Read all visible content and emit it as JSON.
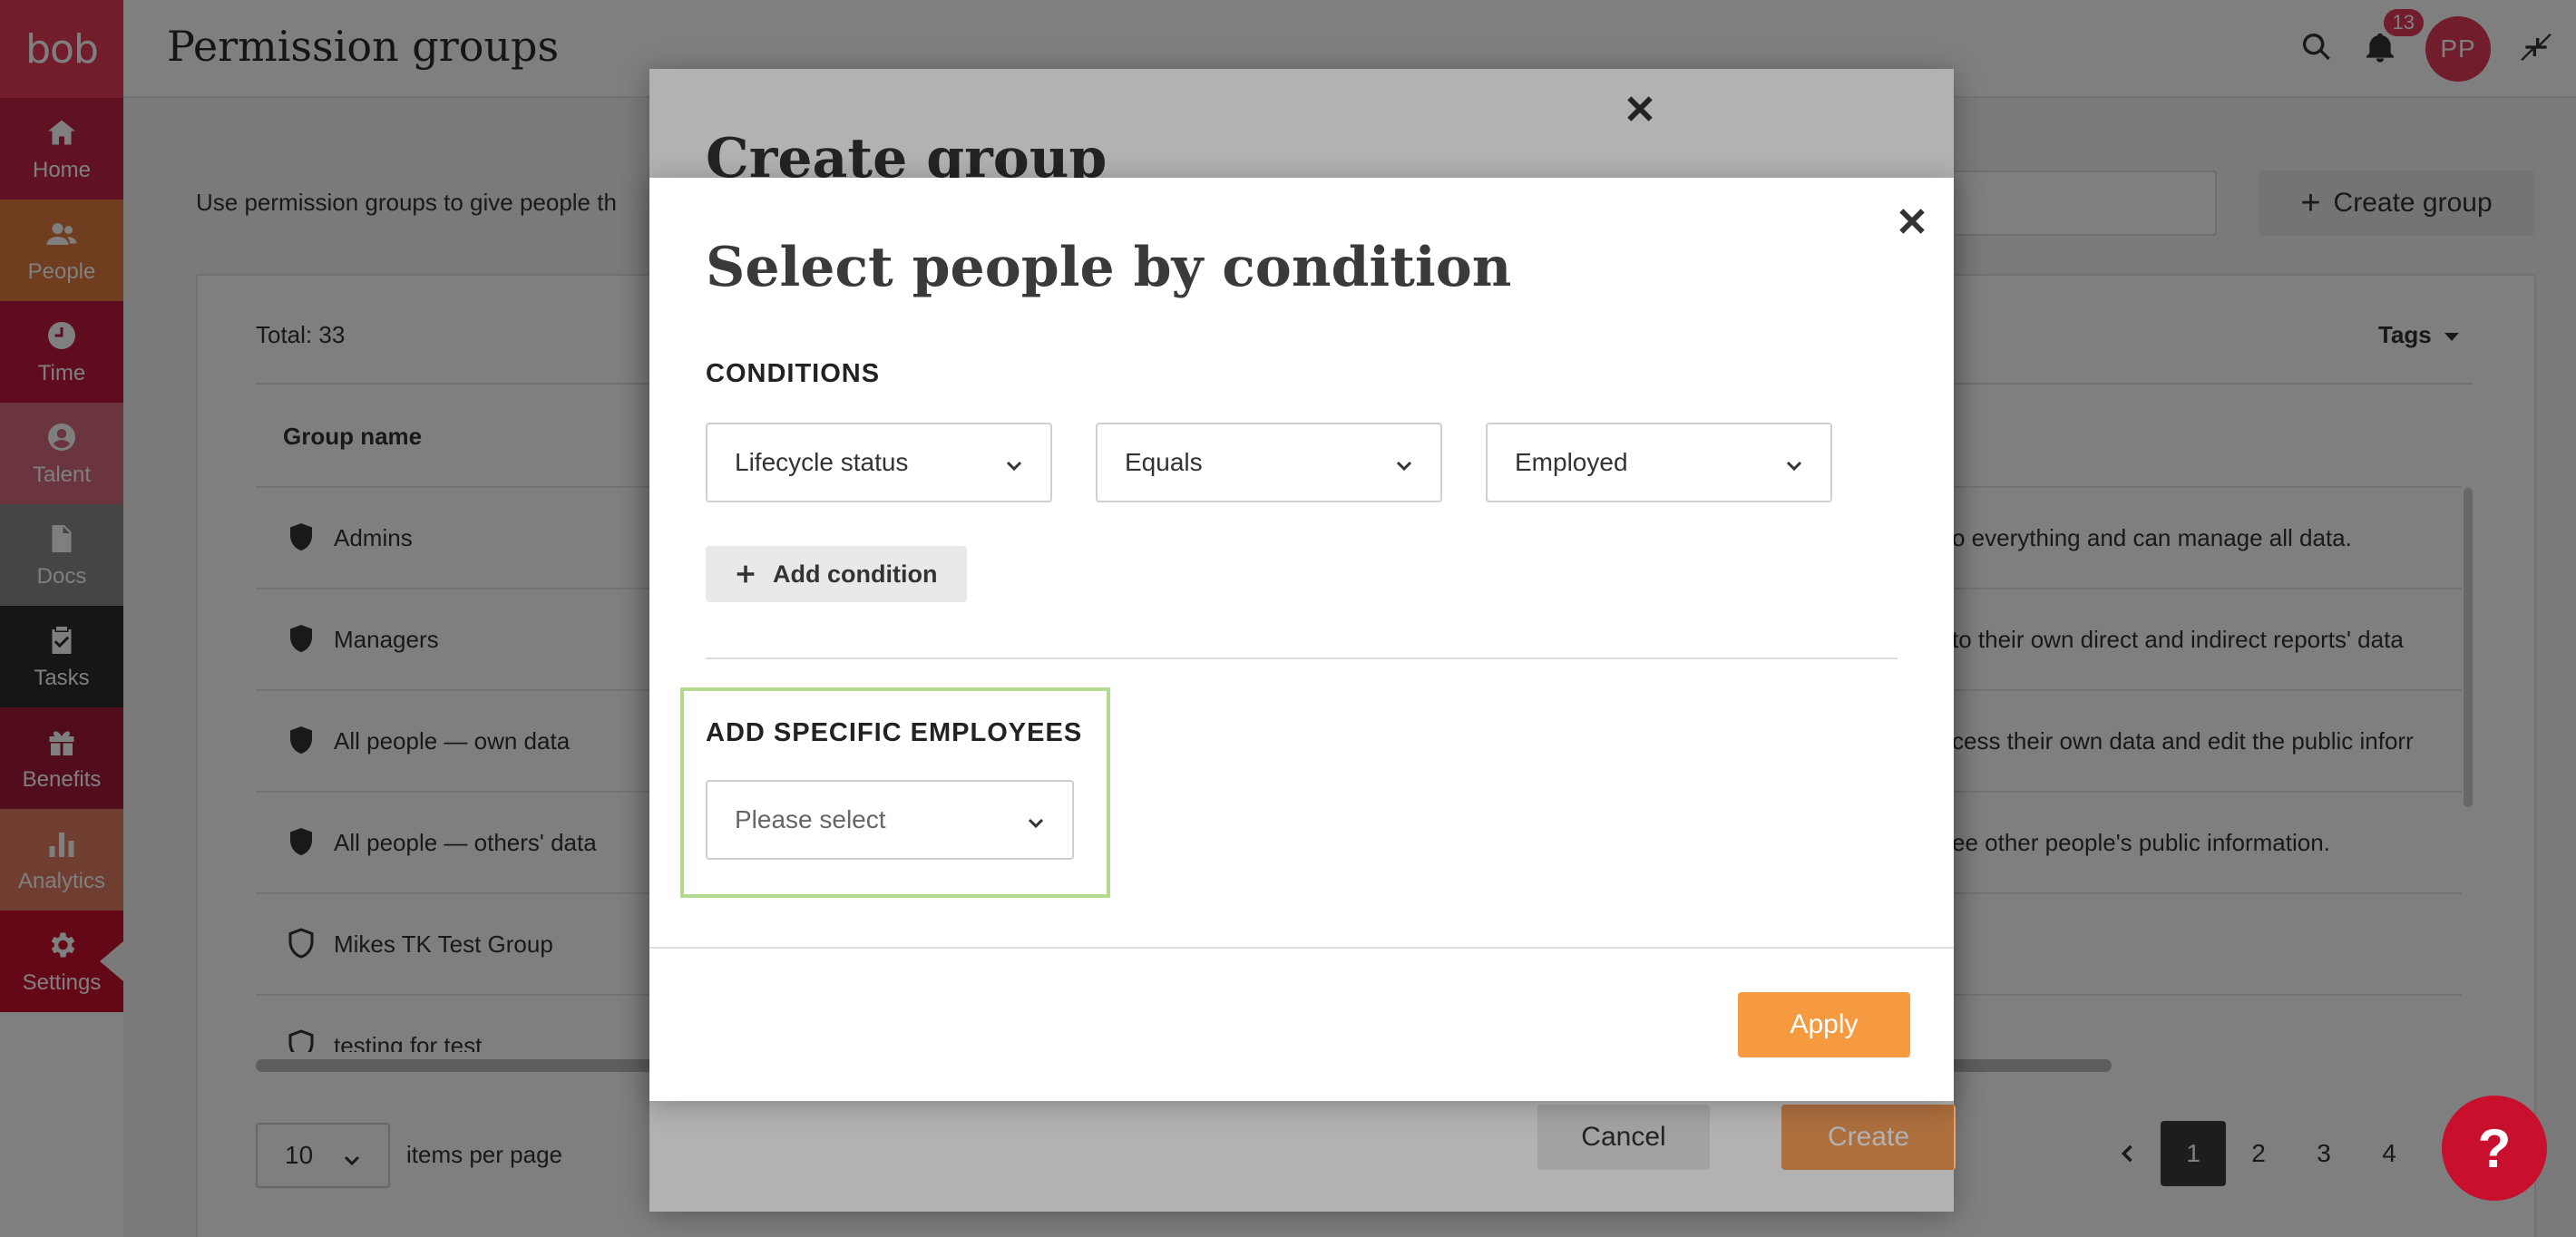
{
  "app": {
    "logo_text": "bob"
  },
  "sidebar": {
    "items": [
      {
        "label": "Home",
        "icon": "home-icon",
        "color": "#c02544"
      },
      {
        "label": "People",
        "icon": "people-icon",
        "color": "#e07a3e"
      },
      {
        "label": "Time",
        "icon": "clock-icon",
        "color": "#c0193f"
      },
      {
        "label": "Talent",
        "icon": "talent-icon",
        "color": "#d46b7e"
      },
      {
        "label": "Docs",
        "icon": "docs-icon",
        "color": "#8a8a8a"
      },
      {
        "label": "Tasks",
        "icon": "tasks-icon",
        "color": "#2d2d2d"
      },
      {
        "label": "Benefits",
        "icon": "gift-icon",
        "color": "#a51a3a"
      },
      {
        "label": "Analytics",
        "icon": "analytics-icon",
        "color": "#de7d63"
      },
      {
        "label": "Settings",
        "icon": "gear-icon",
        "color": "#c8102e"
      }
    ]
  },
  "header": {
    "title": "Permission groups",
    "notifications_count": "13",
    "avatar_initials": "PP"
  },
  "page": {
    "intro": "Use permission groups to give people th",
    "create_group_label": "Create group",
    "total": "Total: 33",
    "tags_label": "Tags",
    "column_group_name": "Group name",
    "rows": [
      {
        "name": "Admins",
        "desc": "o everything and can manage all data."
      },
      {
        "name": "Managers",
        "desc": "to their own direct and indirect reports' data"
      },
      {
        "name": "All people — own data",
        "desc": "cess their own data and edit the public inforr"
      },
      {
        "name": "All people — others' data",
        "desc": "ee other people's public information."
      },
      {
        "name": "Mikes TK Test Group",
        "desc": ""
      },
      {
        "name": "testing for test",
        "desc": ""
      }
    ],
    "per_page_value": "10",
    "per_page_label": "items per page",
    "pages": [
      "1",
      "2",
      "3",
      "4"
    ],
    "current_page": "1",
    "help_label": "?"
  },
  "create_group_modal": {
    "title": "Create group",
    "cancel_label": "Cancel",
    "create_label": "Create"
  },
  "condition_modal": {
    "title": "Select people by condition",
    "conditions_label": "CONDITIONS",
    "field_value": "Lifecycle status",
    "operator_value": "Equals",
    "condition_value": "Employed",
    "add_condition_label": "Add condition",
    "specific_label": "ADD SPECIFIC EMPLOYEES",
    "specific_placeholder": "Please select",
    "apply_label": "Apply"
  },
  "colors": {
    "brand": "#e23b57",
    "apply": "#f59a3f",
    "highlight_border": "#b5d98f"
  }
}
